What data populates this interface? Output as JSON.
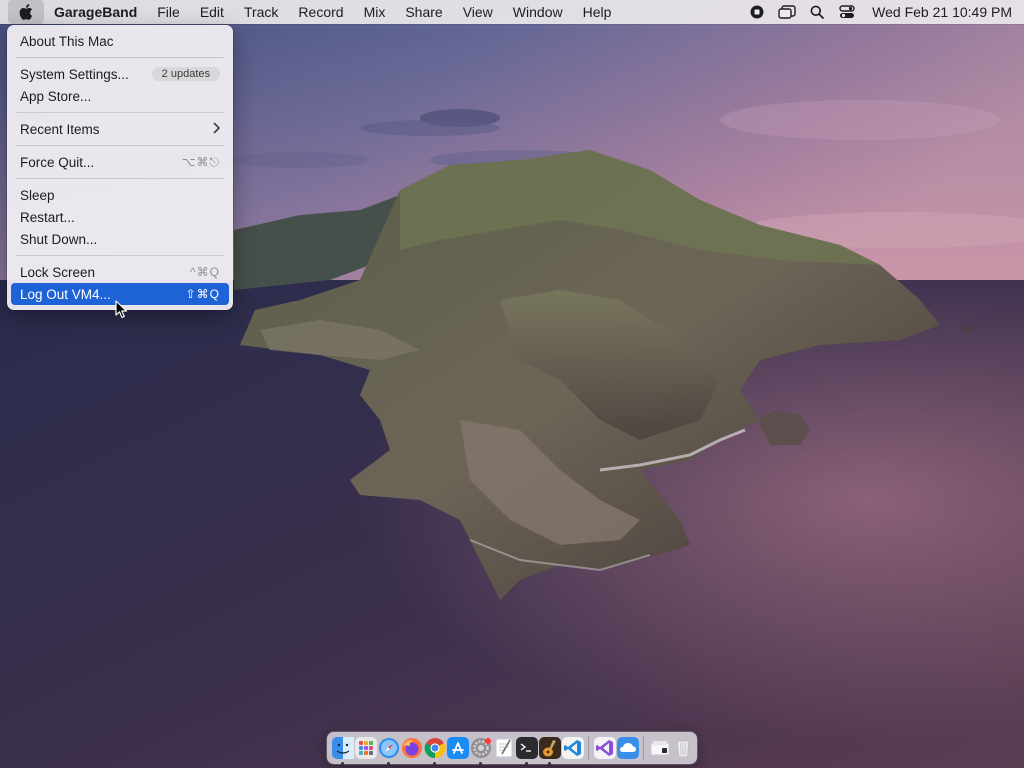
{
  "menubar": {
    "app_name": "GarageBand",
    "menus": [
      "File",
      "Edit",
      "Track",
      "Record",
      "Mix",
      "Share",
      "View",
      "Window",
      "Help"
    ],
    "clock": "Wed Feb 21  10:49 PM",
    "status_icons": [
      "screen-record-icon",
      "stage-manager-icon",
      "spotlight-search-icon",
      "control-center-icon"
    ]
  },
  "apple_menu": {
    "about": "About This Mac",
    "system_settings": "System Settings...",
    "updates_badge": "2 updates",
    "app_store": "App Store...",
    "recent_items": "Recent Items",
    "force_quit": "Force Quit...",
    "force_quit_shortcut": "⌥⌘⎋",
    "sleep": "Sleep",
    "restart": "Restart...",
    "shut_down": "Shut Down...",
    "lock_screen": "Lock Screen",
    "lock_screen_shortcut": "^⌘Q",
    "log_out": "Log Out VM4...",
    "log_out_shortcut": "⇧⌘Q"
  },
  "dock": {
    "apps": [
      "finder-icon",
      "launchpad-icon",
      "safari-icon",
      "firefox-icon",
      "chrome-icon",
      "app-store-icon",
      "system-settings-icon",
      "textedit-icon",
      "terminal-icon",
      "garageband-icon",
      "vscode-icon"
    ],
    "recent_apps": [
      "visual-studio-icon",
      "icloud-drive-icon"
    ],
    "right_items": [
      "downloads-folder-icon",
      "trash-icon"
    ]
  },
  "colors": {
    "menu_highlight": "#1e63d6",
    "menubar_bg": "#ece8ec"
  }
}
